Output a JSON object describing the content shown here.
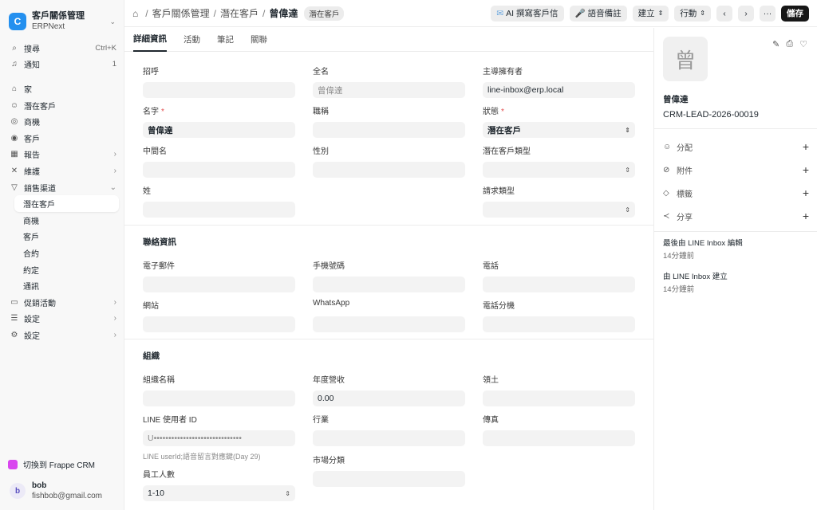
{
  "app": {
    "title": "客戶關係管理",
    "subtitle": "ERPNext",
    "logo": "C"
  },
  "sidebar": {
    "top": [
      {
        "icon": "⌕",
        "label": "搜尋",
        "meta": "Ctrl+K"
      },
      {
        "icon": "♫",
        "label": "通知",
        "meta": "1"
      }
    ],
    "items": [
      {
        "icon": "⌂",
        "label": "家",
        "arrow": ""
      },
      {
        "icon": "☺",
        "label": "潛在客戶",
        "arrow": ""
      },
      {
        "icon": "◎",
        "label": "商機",
        "arrow": ""
      },
      {
        "icon": "◉",
        "label": "客戶",
        "arrow": ""
      },
      {
        "icon": "▦",
        "label": "報告",
        "arrow": "›"
      },
      {
        "icon": "✕",
        "label": "維護",
        "arrow": "›"
      },
      {
        "icon": "▽",
        "label": "銷售渠道",
        "arrow": "⌄"
      }
    ],
    "sub": [
      {
        "label": "潛在客戶"
      },
      {
        "label": "商機"
      },
      {
        "label": "客戶"
      },
      {
        "label": "合約"
      },
      {
        "label": "約定"
      },
      {
        "label": "通訊"
      }
    ],
    "bottom": [
      {
        "icon": "▭",
        "label": "促銷活動",
        "arrow": "›"
      },
      {
        "icon": "☰",
        "label": "設定",
        "arrow": "›"
      },
      {
        "icon": "⚙",
        "label": "設定",
        "arrow": "›"
      }
    ],
    "switch_label": "切換到 Frappe CRM",
    "user": {
      "initial": "b",
      "name": "bob",
      "email": "fishbob@gmail.com"
    }
  },
  "topbar": {
    "crumbs": [
      "客戶關係管理",
      "潛在客戶"
    ],
    "current": "曾偉達",
    "badge": "潛在客戶",
    "ai_btn": "AI 撰寫客戶信",
    "voice_btn": "語音備註",
    "create_btn": "建立",
    "action_btn": "行動",
    "more": "···",
    "save": "儲存"
  },
  "tabs": [
    "詳細資訊",
    "活動",
    "筆記",
    "關聯"
  ],
  "form": {
    "s1": {
      "salutation": {
        "label": "招呼",
        "value": ""
      },
      "full_name": {
        "label": "全名",
        "value": "曾偉達"
      },
      "owner": {
        "label": "主導擁有者",
        "value": "line-inbox@erp.local"
      },
      "first_name": {
        "label": "名字",
        "value": "曾偉達"
      },
      "job_title": {
        "label": "職稱",
        "value": ""
      },
      "status": {
        "label": "狀態",
        "value": "潛在客戶"
      },
      "middle_name": {
        "label": "中間名",
        "value": ""
      },
      "gender": {
        "label": "性別",
        "value": ""
      },
      "lead_type": {
        "label": "潛在客戶類型",
        "value": ""
      },
      "last_name": {
        "label": "姓",
        "value": ""
      },
      "request_type": {
        "label": "請求類型",
        "value": ""
      }
    },
    "s2": {
      "title": "聯絡資訊",
      "email": {
        "label": "電子郵件",
        "value": ""
      },
      "mobile": {
        "label": "手機號碼",
        "value": ""
      },
      "phone": {
        "label": "電話",
        "value": ""
      },
      "website": {
        "label": "網站",
        "value": ""
      },
      "whatsapp": {
        "label": "WhatsApp",
        "value": ""
      },
      "ext": {
        "label": "電話分機",
        "value": ""
      }
    },
    "s3": {
      "title": "組織",
      "org_name": {
        "label": "組織名稱",
        "value": ""
      },
      "revenue": {
        "label": "年度營收",
        "value": "0.00"
      },
      "territory": {
        "label": "領土",
        "value": ""
      },
      "line_id": {
        "label": "LINE 使用者 ID",
        "value": "U••••••••••••••••••••••••••••••",
        "hint": "LINE userId;語音留言對應鍵(Day 29)"
      },
      "industry": {
        "label": "行業",
        "value": ""
      },
      "fax": {
        "label": "傳真",
        "value": ""
      },
      "market": {
        "label": "市場分類",
        "value": ""
      },
      "employees": {
        "label": "員工人數",
        "value": "1-10"
      }
    }
  },
  "panel": {
    "avatar": "曾",
    "name": "曾偉達",
    "id": "CRM-LEAD-2026-00019",
    "actions": [
      "分配",
      "附件",
      "標籤",
      "分享"
    ],
    "log1": {
      "text": "最後由 LINE Inbox 編輯",
      "time": "14分鐘前"
    },
    "log2": {
      "text": "由 LINE Inbox 建立",
      "time": "14分鐘前"
    }
  }
}
